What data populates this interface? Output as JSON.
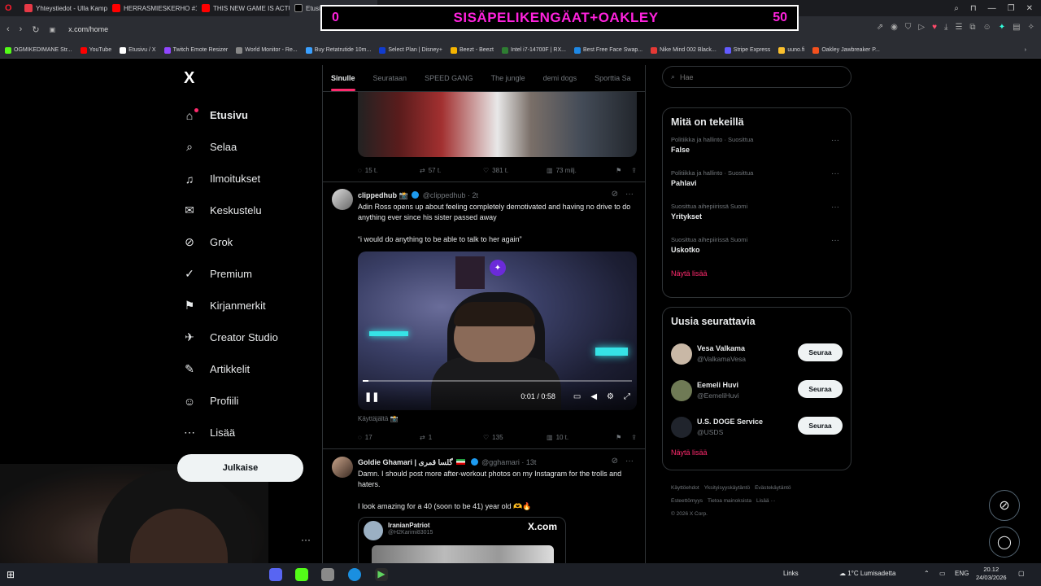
{
  "browser": {
    "tabs": [
      {
        "title": "Yhteystiedot - Ulla Kampr",
        "color": "#e63946"
      },
      {
        "title": "HERRASMIESKERHO #15 |",
        "color": "#ff0000"
      },
      {
        "title": "THIS NEW GAME IS ACTU",
        "color": "#ff0000"
      },
      {
        "title": "Etusivu / X",
        "color": "#000000"
      }
    ],
    "new_tab": "+",
    "url": "x.com/home",
    "bookmarks": [
      {
        "label": "OGMIKEDIMANE Str...",
        "color": "#53fc18"
      },
      {
        "label": "YouTube",
        "color": "#ff0000"
      },
      {
        "label": "Etusivu / X",
        "color": "#ffffff"
      },
      {
        "label": "Twitch Emote Resizer",
        "color": "#9146ff"
      },
      {
        "label": "World Monitor - Re...",
        "color": "#888888"
      },
      {
        "label": "Buy Retatrutide 10m...",
        "color": "#3aa0ff"
      },
      {
        "label": "Select Plan | Disney+",
        "color": "#113ccf"
      },
      {
        "label": "Beezt - Beezt",
        "color": "#f5b400"
      },
      {
        "label": "Intel i7-14700F | RX...",
        "color": "#2e7d32"
      },
      {
        "label": "Best Free Face Swap...",
        "color": "#1e88e5"
      },
      {
        "label": "Nike Mind 002 Black...",
        "color": "#e53935"
      },
      {
        "label": "Stripe Express",
        "color": "#635bff"
      },
      {
        "label": "uuno.fi",
        "color": "#fbc02d"
      },
      {
        "label": "Oakley Jawbreaker P...",
        "color": "#f4511e"
      }
    ]
  },
  "overlay": {
    "left": "0",
    "title": "SISÄPELIKENGÄAT+OAKLEY",
    "right": "50"
  },
  "nav": {
    "logo": "X",
    "items": [
      {
        "label": "Etusivu",
        "icon": "⌂"
      },
      {
        "label": "Selaa",
        "icon": "⌕"
      },
      {
        "label": "Ilmoitukset",
        "icon": "♫"
      },
      {
        "label": "Keskustelu",
        "icon": "✉"
      },
      {
        "label": "Grok",
        "icon": "⊘"
      },
      {
        "label": "Premium",
        "icon": "✓"
      },
      {
        "label": "Kirjanmerkit",
        "icon": "⚑"
      },
      {
        "label": "Creator Studio",
        "icon": "✈"
      },
      {
        "label": "Artikkelit",
        "icon": "✎"
      },
      {
        "label": "Profiili",
        "icon": "☺"
      },
      {
        "label": "Lisää",
        "icon": "⋯"
      }
    ],
    "post_button": "Julkaise",
    "more": "···"
  },
  "feed": {
    "tabs": [
      "Sinulle",
      "Seurataan",
      "SPEED GANG",
      "The jungle",
      "demi dogs",
      "Sporttia Sa"
    ],
    "tweet0": {
      "replies": "15 t.",
      "retweets": "57 t.",
      "likes": "381 t.",
      "views": "73 milj."
    },
    "tweet1": {
      "name": "clippedhub",
      "emoji": "📸",
      "handle": "@clippedhub",
      "time": "· 2t",
      "text1": "Adin Ross opens up about feeling completely demotivated and having no drive to do anything ever since his sister passed away",
      "text2": "“i would do anything to be able to talk to her again”",
      "video_time": "0:01 / 0:58",
      "video_progress": 0.02,
      "caption": "Käyttäjältä 📸",
      "replies": "17",
      "retweets": "1",
      "likes": "135",
      "views": "10 t."
    },
    "tweet2": {
      "name": "Goldie Ghamari | گلسا قمری",
      "handle": "@gghamari",
      "time": "· 13t",
      "text1": "Damn. I should post more after-workout photos on my Instagram for the trolls and haters.",
      "text2": "I look amazing for a 40 (soon to be 41) year old 🫶🔥",
      "quote_name": "IranianPatriot",
      "quote_handle": "@H2Karimi83015",
      "quote_brand": "X.com"
    }
  },
  "sidebar": {
    "search_placeholder": "Hae",
    "trends_title": "Mitä on tekeillä",
    "trends": [
      {
        "meta": "Politiikka ja hallinto · Suosittua",
        "topic": "False"
      },
      {
        "meta": "Politiikka ja hallinto · Suosittua",
        "topic": "Pahlavi"
      },
      {
        "meta": "Suosittua aihepiirissä Suomi",
        "topic": "Yritykset"
      },
      {
        "meta": "Suosittua aihepiirissä Suomi",
        "topic": "Uskotko"
      }
    ],
    "show_more": "Näytä lisää",
    "follow_title": "Uusia seurattavia",
    "follow": [
      {
        "name": "Vesa Valkama",
        "handle": "@ValkamaVesa",
        "button": "Seuraa",
        "color": "#c9b8a6"
      },
      {
        "name": "Eemeli Huvi",
        "handle": "@EemeliHuvi",
        "button": "Seuraa",
        "color": "#6f7a55"
      },
      {
        "name": "U.S. DOGE Service",
        "handle": "@USDS",
        "button": "Seuraa",
        "color": "#20242c"
      }
    ],
    "show_more2": "Näytä lisää",
    "footer": [
      "Käyttöehdot",
      "Yksityisyyskäytäntö",
      "Evästekäytäntö",
      "Esteettömyys",
      "Tietoa mainoksista",
      "Lisää ···",
      "© 2026 X Corp."
    ]
  },
  "taskbar": {
    "links": "Links",
    "weather": "1°C  Lumisadetta",
    "lang": "ENG",
    "time": "20.12",
    "date": "24/03/2026"
  }
}
